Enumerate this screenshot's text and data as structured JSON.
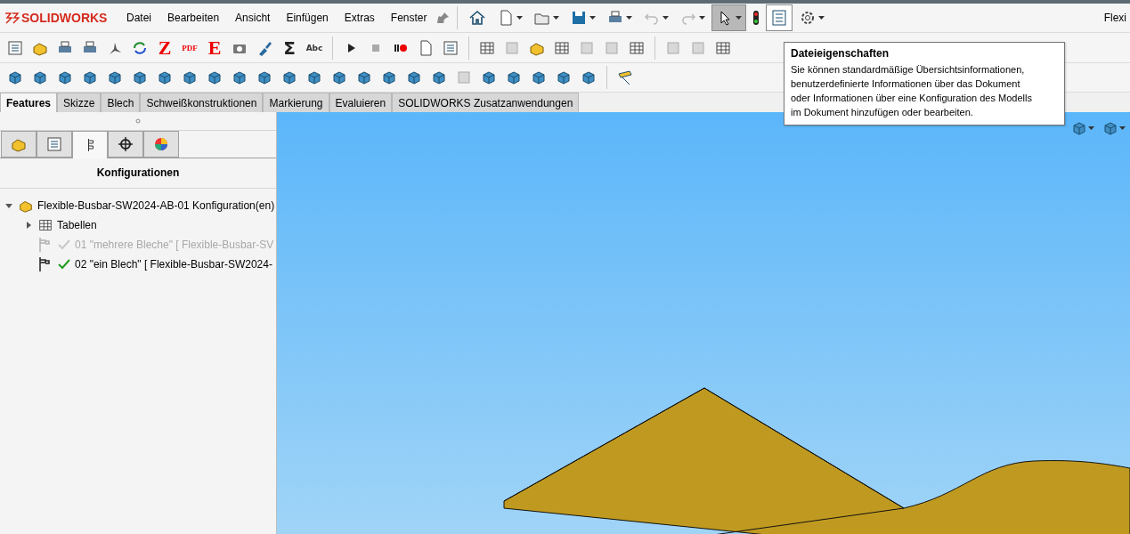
{
  "app": {
    "logo": "SOLIDWORKS",
    "title": "Flexi"
  },
  "menu": [
    "Datei",
    "Bearbeiten",
    "Ansicht",
    "Einfügen",
    "Extras",
    "Fenster"
  ],
  "quick_access": [
    {
      "kind": "home",
      "selected": false
    },
    {
      "kind": "new",
      "selected": false
    },
    {
      "kind": "open",
      "selected": false
    },
    {
      "kind": "save",
      "selected": false
    },
    {
      "kind": "print",
      "selected": false
    },
    {
      "kind": "undo",
      "selected": false
    },
    {
      "kind": "redo",
      "selected": false
    },
    {
      "kind": "select",
      "selected": true
    },
    {
      "kind": "rebuild",
      "selected": false
    },
    {
      "kind": "properties",
      "selected": false
    },
    {
      "kind": "options",
      "selected": false
    }
  ],
  "macro_glyphs": [
    {
      "kind": "red-letter",
      "text": "Z"
    },
    {
      "kind": "red-small",
      "text": "PDF"
    },
    {
      "kind": "red-letter",
      "text": "E"
    },
    {
      "kind": "camera"
    },
    {
      "kind": "brush"
    },
    {
      "kind": "dark-letter",
      "text": "Σ"
    },
    {
      "kind": "spell",
      "text": "Abc"
    }
  ],
  "command_tabs": [
    {
      "label": "Features",
      "selected": true
    },
    {
      "label": "Skizze",
      "selected": false
    },
    {
      "label": "Blech",
      "selected": false
    },
    {
      "label": "Schweißkonstruktionen",
      "selected": false
    },
    {
      "label": "Markierung",
      "selected": false
    },
    {
      "label": "Evaluieren",
      "selected": false
    },
    {
      "label": "SOLIDWORKS Zusatzanwendungen",
      "selected": false
    }
  ],
  "panel_tabs": [
    {
      "kind": "feature-tree",
      "selected": false
    },
    {
      "kind": "property-manager",
      "selected": false
    },
    {
      "kind": "configuration-manager",
      "selected": true
    },
    {
      "kind": "dimxpert",
      "selected": false
    },
    {
      "kind": "display-manager",
      "selected": false
    }
  ],
  "panel": {
    "heading": "Konfigurationen",
    "tree": [
      {
        "kind": "part",
        "label": "Flexible-Busbar-SW2024-AB-01 Konfiguration(en)",
        "expanded": true,
        "children": [
          {
            "kind": "folder",
            "label": "Tabellen",
            "expanded": false
          },
          {
            "kind": "config",
            "label": "01 \"mehrere Bleche\" [ Flexible-Busbar-SV",
            "active": false
          },
          {
            "kind": "config",
            "label": "02 \"ein Blech\" [ Flexible-Busbar-SW2024-",
            "active": true
          }
        ]
      }
    ]
  },
  "tooltip": {
    "title": "Dateieigenschaften",
    "lines": [
      "Sie können standardmäßige Übersichtsinformationen,",
      "benutzerdefinierte Informationen über das Dokument",
      "oder Informationen über eine Konfiguration des Modells",
      "im Dokument hinzufügen oder bearbeiten."
    ]
  }
}
